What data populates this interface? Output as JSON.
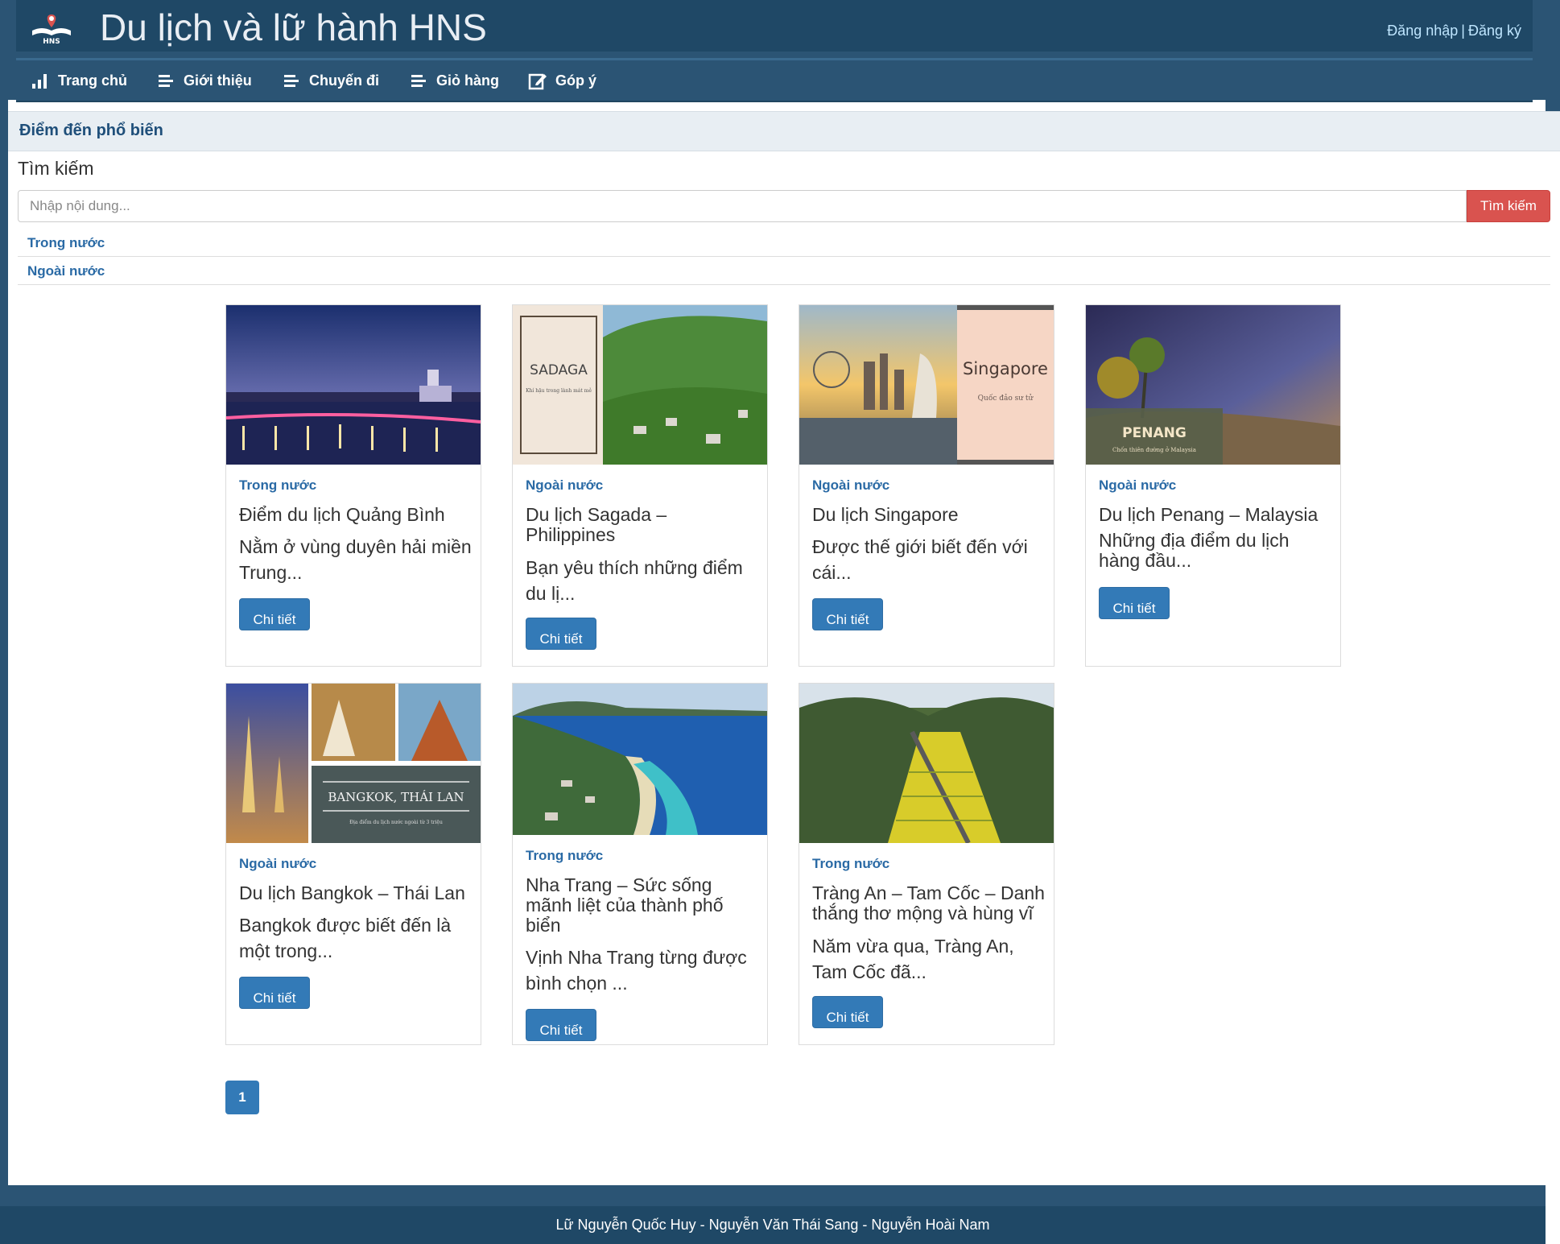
{
  "header": {
    "site_title": "Du lịch và lữ hành HNS",
    "logo_text": "HNS",
    "login_label": "Đăng nhập",
    "separator": "|",
    "register_label": "Đăng ký"
  },
  "nav": {
    "items": [
      {
        "label": "Trang chủ",
        "icon": "bar-chart-icon"
      },
      {
        "label": "Giới thiệu",
        "icon": "list-icon"
      },
      {
        "label": "Chuyến đi",
        "icon": "list-icon"
      },
      {
        "label": "Giỏ hàng",
        "icon": "list-icon"
      },
      {
        "label": "Góp ý",
        "icon": "edit-icon"
      }
    ]
  },
  "section": {
    "heading": "Điểm đến phổ biến",
    "search_label": "Tìm kiếm",
    "search_placeholder": "Nhập nội dung...",
    "search_button": "Tìm kiếm",
    "filters": [
      "Trong nước",
      "Ngoài nước"
    ]
  },
  "cards": [
    {
      "category": "Trong nước",
      "title": "Điểm du lịch Quảng Bình",
      "desc": "Nằm ở vùng duyên hải miền Trung...",
      "button": "Chi tiết"
    },
    {
      "category": "Ngoài nước",
      "title": "Du lịch Sagada – Philippines",
      "desc": "Bạn yêu thích những điểm du lị...",
      "button": "Chi tiết",
      "image_text": "SADAGA",
      "image_subtext": "Khí hậu trong lành mát mẻ"
    },
    {
      "category": "Ngoài nước",
      "title": "Du lịch Singapore",
      "desc": "Được thế giới biết đến với cái...",
      "button": "Chi tiết",
      "image_text": "Singapore",
      "image_subtext": "Quốc đảo sư tử"
    },
    {
      "category": "Ngoài nước",
      "title": "Du lịch Penang – Malaysia",
      "desc": "Những địa điểm du lịch hàng đầu...",
      "button": "Chi tiết",
      "image_text": "PENANG",
      "image_subtext": "Chốn thiên đường ở Malaysia"
    },
    {
      "category": "Ngoài nước",
      "title": "Du lịch Bangkok – Thái Lan",
      "desc": "Bangkok được biết đến là một trong...",
      "button": "Chi tiết",
      "image_text": "BANGKOK, THÁI LAN",
      "image_subtext": "Địa điểm du lịch nước ngoài từ 3 triệu"
    },
    {
      "category": "Trong nước",
      "title": "Nha Trang – Sức sống mãnh liệt của thành phố biển",
      "desc": "Vịnh Nha Trang từng được bình chọn ...",
      "button": "Chi tiết"
    },
    {
      "category": "Trong nước",
      "title": "Tràng An – Tam Cốc – Danh thắng thơ mộng và hùng vĩ",
      "desc": "Năm vừa qua, Tràng An, Tam Cốc đã...",
      "button": "Chi tiết"
    }
  ],
  "pagination": {
    "current": "1"
  },
  "footer": {
    "text": "Lữ Nguyễn Quốc Huy - Nguyễn Văn Thái Sang - Nguyễn Hoài Nam"
  }
}
